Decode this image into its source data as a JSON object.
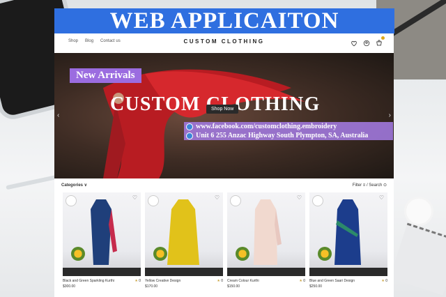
{
  "banner": {
    "title": "WEB APPLICAITON"
  },
  "nav": {
    "links": [
      "Shop",
      "Blog",
      "Contact us"
    ],
    "brand": "CUSTOM CLOTHING",
    "icons": [
      "heart-icon",
      "user-icon",
      "cart-icon"
    ],
    "cart_count": "0"
  },
  "hero": {
    "badge": "New Arrivals",
    "title": "CUSTOM CLOTHING",
    "button": "Shop Now",
    "facebook": "www.facebook.com/customclothing.embroidery",
    "address": "Unit 6 255 Anzac Highway South Plympton, SA, Australia",
    "prev_arrow": "‹",
    "next_arrow": "›"
  },
  "catalog": {
    "categories_label": "Categories ∨",
    "filter_label": "Filter ≡ / Search ⊙",
    "products": [
      {
        "name": "Black and Green Sparkling Kurthi",
        "price": "$300.00",
        "rating": "0",
        "color": "#1f3f7a"
      },
      {
        "name": "Yellow Creative Design",
        "price": "$170.00",
        "rating": "0",
        "color": "#e1c21a"
      },
      {
        "name": "Cream Colour Kurthi",
        "price": "$150.00",
        "rating": "0",
        "color": "#f1d9cf"
      },
      {
        "name": "Blue and Green Saari Design",
        "price": "$250.00",
        "rating": "0",
        "color": "#1c3d8c"
      }
    ]
  },
  "colors": {
    "banner": "#2f6fe0",
    "badge": "#9b6ce0",
    "dress": "#b81c22"
  }
}
